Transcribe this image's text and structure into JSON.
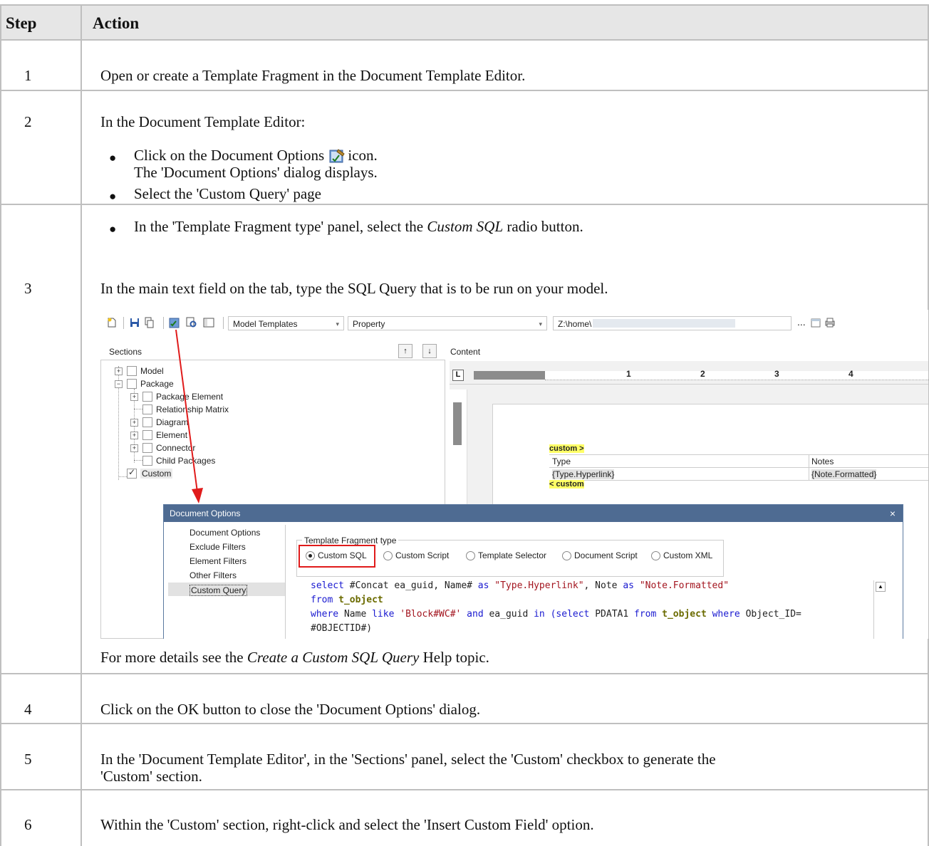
{
  "table": {
    "header_step": "Step",
    "header_action": "Action"
  },
  "rows": [
    {
      "step": "1",
      "text": "Open or create a Template Fragment in the Document Template Editor."
    },
    {
      "step": "2",
      "text": "In the Document Template Editor:",
      "bullets": [
        {
          "a": "Click on the Document Options ",
          "b": "icon.",
          "c": "The 'Document Options' dialog displays."
        },
        {
          "a": "Select the 'Custom Query' page"
        },
        {
          "a": "In the 'Template Fragment type' panel, select the ",
          "em": "Custom SQL",
          "b": " radio button."
        }
      ]
    },
    {
      "step": "3",
      "text": "In the main text field on the tab, type the SQL Query that is to be run on your model.",
      "after_a": "For more details see the ",
      "after_em": "Create a Custom SQL Query",
      "after_b": " Help topic."
    },
    {
      "step": "4",
      "text": "Click on the OK button to close the 'Document Options' dialog."
    },
    {
      "step": "5",
      "text": "In the 'Document Template Editor', in the 'Sections' panel, select the 'Custom' checkbox to generate the",
      "text2": "'Custom' section."
    },
    {
      "step": "6",
      "text": "Within the 'Custom' section, right-click and select the 'Insert Custom Field' option."
    }
  ],
  "shot": {
    "combo_templates": "Model Templates",
    "combo_property": "Property",
    "path": "Z:\\home\\",
    "ellipsis": "...",
    "sections_label": "Sections",
    "content_label": "Content",
    "tree": [
      "Model",
      "Package",
      "Package Element",
      "Relationship Matrix",
      "Diagram",
      "Element",
      "Connector",
      "Child Packages",
      "Custom"
    ],
    "ruler": [
      "1",
      "2",
      "3",
      "4"
    ],
    "custom_open": "custom >",
    "col_type": "Type",
    "col_notes": "Notes",
    "field_type": "{Type.Hyperlink}",
    "field_notes": "{Note.Formatted}",
    "custom_close": "< custom",
    "dialog": {
      "title": "Document Options",
      "close": "×",
      "nav": [
        "Document Options",
        "Exclude Filters",
        "Element Filters",
        "Other Filters",
        "Custom Query"
      ],
      "group": "Template Fragment type",
      "radios": [
        "Custom SQL",
        "Custom Script",
        "Template Selector",
        "Document Script",
        "Custom XML"
      ],
      "sql": {
        "l1a": "select ",
        "l1b": "#Concat ea_guid, Name#",
        "l1c": " as ",
        "l1d": "\"Type.Hyperlink\"",
        "l1e": ", Note ",
        "l1f": "as ",
        "l1g": "\"Note.Formatted\"",
        "l2a": "from ",
        "l2b": "t_object",
        "l3a": "where ",
        "l3b": "Name ",
        "l3c": "like ",
        "l3d": "'Block#WC#'",
        "l3e": " and ",
        "l3f": "ea_guid ",
        "l3g": "in ",
        "l3h": "(select ",
        "l3i": "PDATA1 ",
        "l3j": "from ",
        "l3k": "t_object ",
        "l3l": "where ",
        "l3m": "Object_ID=",
        "l4a": "#OBJECTID#",
        "l4b": ")"
      }
    }
  }
}
